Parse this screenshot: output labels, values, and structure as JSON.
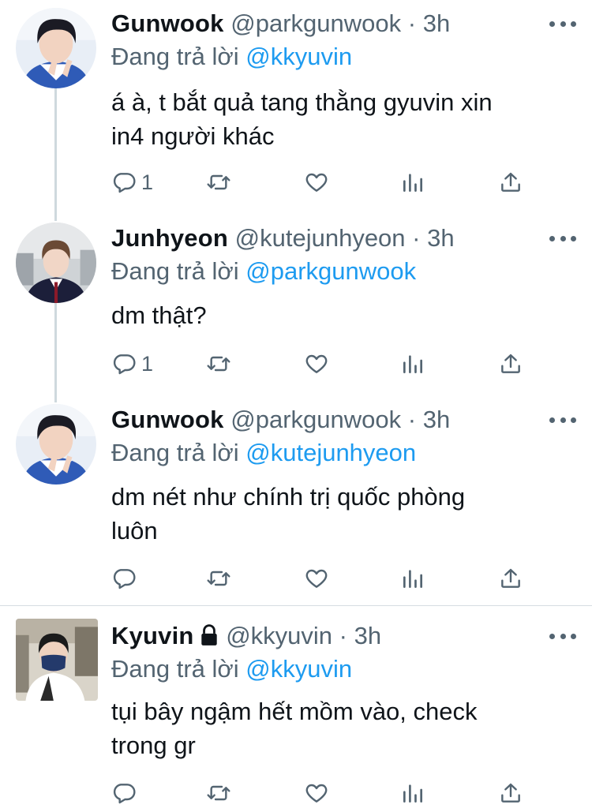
{
  "tweets": [
    {
      "name": "Gunwook",
      "handle": "@parkgunwook",
      "time": "3h",
      "reply_prefix": "Đang trả lời",
      "reply_to": "@kkyuvin",
      "text_lines": [
        "á à, t bắt quả tang thằng gyuvin xin",
        "in4 người khác"
      ],
      "reply_count": "1",
      "avatar": "gunwook-avatar"
    },
    {
      "name": "Junhyeon",
      "handle": "@kutejunhyeon",
      "time": "3h",
      "reply_prefix": "Đang trả lời",
      "reply_to": "@parkgunwook",
      "text_lines": [
        "dm thật?"
      ],
      "reply_count": "1",
      "avatar": "junhyeon-avatar"
    },
    {
      "name": "Gunwook",
      "handle": "@parkgunwook",
      "time": "3h",
      "reply_prefix": "Đang trả lời",
      "reply_to": "@kutejunhyeon",
      "text_lines": [
        "dm nét như chính trị quốc phòng",
        "luôn"
      ],
      "reply_count": "",
      "avatar": "gunwook-avatar"
    },
    {
      "name": "Kyuvin",
      "handle": "@kkyuvin",
      "time": "3h",
      "reply_prefix": "Đang trả lời",
      "reply_to": "@kkyuvin",
      "text_lines": [
        "tụi bây ngậm hết mồm vào, check",
        "trong gr"
      ],
      "reply_count": "",
      "avatar": "kyuvin-avatar",
      "protected": true
    }
  ],
  "separator": "·",
  "colors": {
    "link": "#1d9bf0",
    "muted": "#536471",
    "text": "#0f1419",
    "thread": "#cfd9de"
  }
}
